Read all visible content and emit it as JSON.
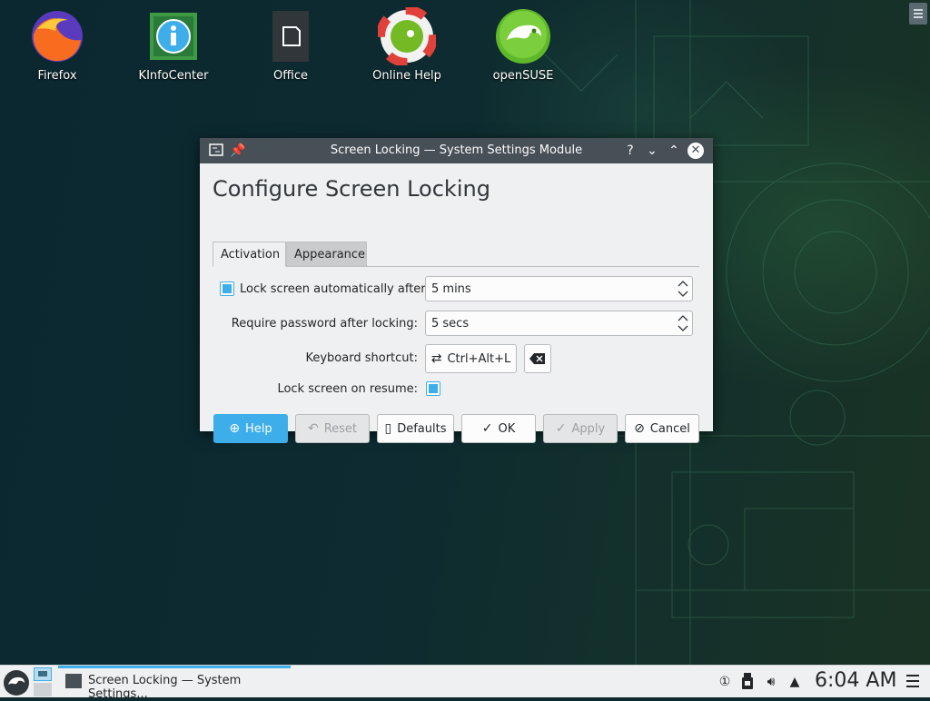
{
  "desktop": {
    "icons": [
      {
        "label": "Firefox",
        "icon": "firefox-icon"
      },
      {
        "label": "KInfoCenter",
        "icon": "info-center-icon"
      },
      {
        "label": "Office",
        "icon": "office-document-icon"
      },
      {
        "label": "Online Help",
        "icon": "help-lifebuoy-icon"
      },
      {
        "label": "openSUSE",
        "icon": "opensuse-chameleon-icon"
      }
    ]
  },
  "window": {
    "title": "Screen Locking — System Settings Module",
    "heading": "Configure Screen Locking",
    "tabs": [
      "Activation",
      "Appearance"
    ],
    "active_tab": "Activation",
    "lock_auto_label": "Lock screen automatically after:",
    "lock_auto_checked": true,
    "lock_auto_value": "5 mins",
    "password_label": "Require password after locking:",
    "password_value": "5 secs",
    "shortcut_label": "Keyboard shortcut:",
    "shortcut_value": "Ctrl+Alt+L",
    "resume_label": "Lock screen on resume:",
    "resume_checked": true,
    "buttons": {
      "help": "Help",
      "reset": "Reset",
      "defaults": "Defaults",
      "ok": "OK",
      "apply": "Apply",
      "cancel": "Cancel"
    }
  },
  "taskbar": {
    "task_label": "Screen Locking — System Settings...",
    "clock": "6:04 AM"
  },
  "colors": {
    "accent": "#3daee9",
    "titlebar": "#475057",
    "window_bg": "#eff0f1"
  }
}
